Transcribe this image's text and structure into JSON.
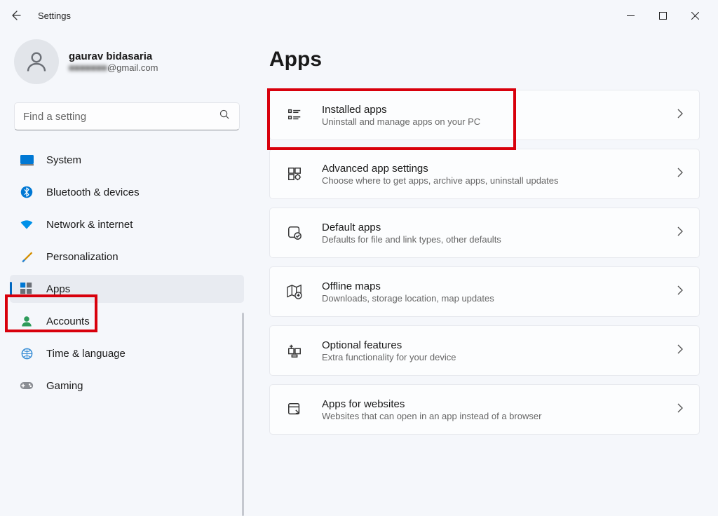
{
  "window": {
    "title": "Settings"
  },
  "profile": {
    "name": "gaurav bidasaria",
    "email_hidden": "■■■■■■■",
    "email_domain": "@gmail.com"
  },
  "search": {
    "placeholder": "Find a setting"
  },
  "nav": {
    "system": "System",
    "bluetooth": "Bluetooth & devices",
    "network": "Network & internet",
    "personalization": "Personalization",
    "apps": "Apps",
    "accounts": "Accounts",
    "time": "Time & language",
    "gaming": "Gaming"
  },
  "page": {
    "title": "Apps"
  },
  "cards": {
    "installed": {
      "title": "Installed apps",
      "sub": "Uninstall and manage apps on your PC"
    },
    "advanced": {
      "title": "Advanced app settings",
      "sub": "Choose where to get apps, archive apps, uninstall updates"
    },
    "default": {
      "title": "Default apps",
      "sub": "Defaults for file and link types, other defaults"
    },
    "maps": {
      "title": "Offline maps",
      "sub": "Downloads, storage location, map updates"
    },
    "optional": {
      "title": "Optional features",
      "sub": "Extra functionality for your device"
    },
    "websites": {
      "title": "Apps for websites",
      "sub": "Websites that can open in an app instead of a browser"
    }
  }
}
